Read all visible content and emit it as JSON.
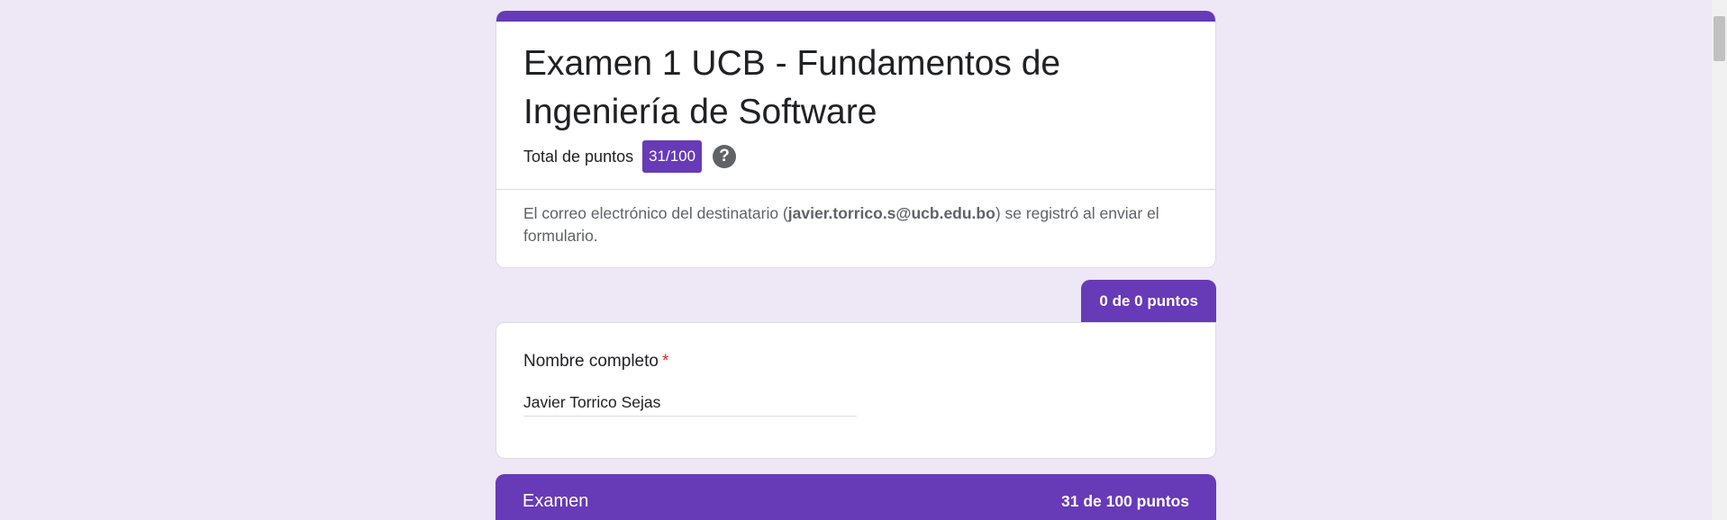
{
  "header": {
    "title": "Examen 1 UCB - Fundamentos de Ingeniería de Software",
    "total_label": "Total de puntos",
    "score": "31/100",
    "help_glyph": "?",
    "email_note_prefix": "El correo electrónico del destinatario (",
    "email": "javier.torrico.s@ucb.edu.bo",
    "email_note_suffix": ") se registró al enviar el formulario."
  },
  "section1": {
    "points": "0 de 0 puntos",
    "question": {
      "label": "Nombre completo",
      "required_mark": "*",
      "answer": "Javier Torrico Sejas"
    }
  },
  "section2": {
    "title": "Examen",
    "points": "31 de 100 puntos"
  },
  "colors": {
    "accent": "#673ab7",
    "background": "#ede7f6",
    "required": "#d93025"
  },
  "icons": {
    "help": "help-circle-icon"
  }
}
